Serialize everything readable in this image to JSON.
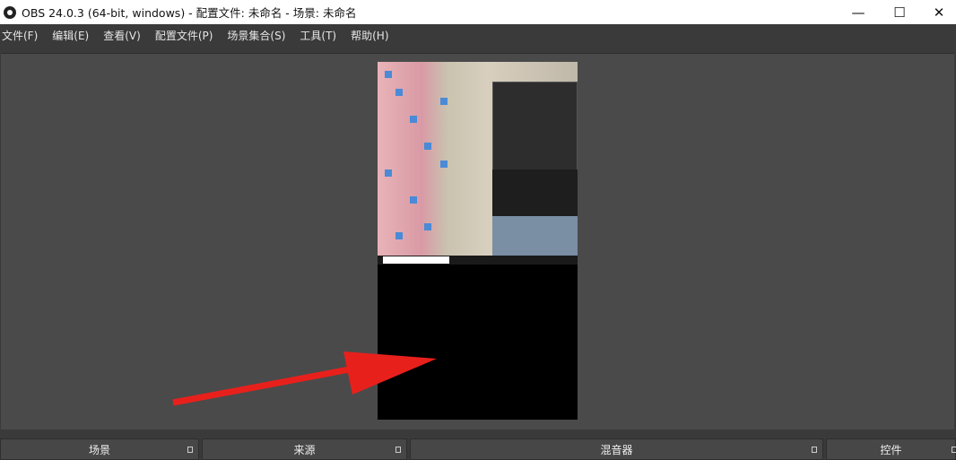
{
  "title": "OBS 24.0.3 (64-bit, windows) - 配置文件: 未命名 - 场景: 未命名",
  "window_controls": {
    "minimize": "—",
    "maximize": "☐",
    "close": "✕"
  },
  "menu": [
    "文件(F)",
    "编辑(E)",
    "查看(V)",
    "配置文件(P)",
    "场景集合(S)",
    "工具(T)",
    "帮助(H)"
  ],
  "docks": [
    "场景",
    "来源",
    "混音器",
    "控件"
  ],
  "colors": {
    "arrow": "#e8201c",
    "preview_bg": "#4a4a4a",
    "canvas": "#000000"
  }
}
